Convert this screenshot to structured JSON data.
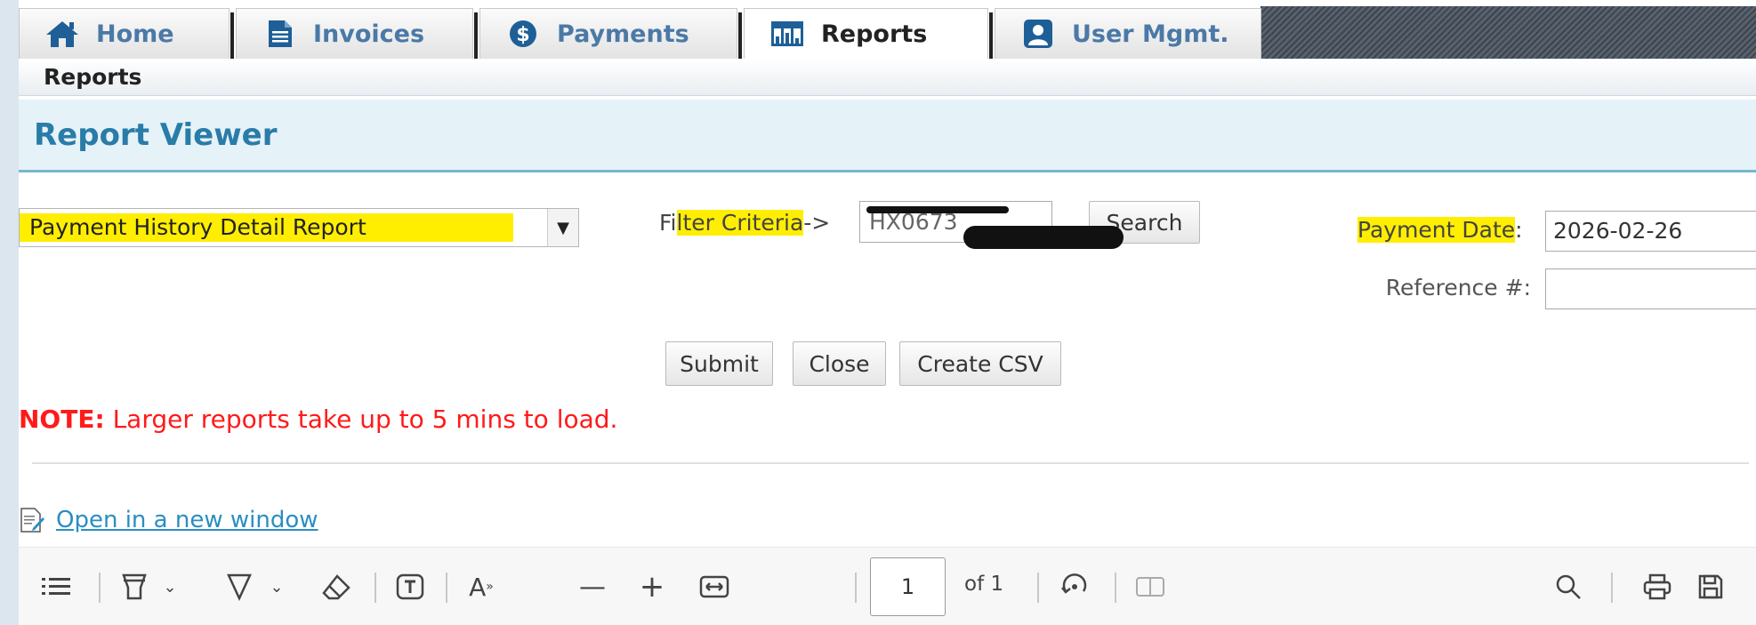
{
  "tabs": [
    {
      "label": "Home",
      "icon": "home-icon"
    },
    {
      "label": "Invoices",
      "icon": "invoice-icon"
    },
    {
      "label": "Payments",
      "icon": "payment-icon"
    },
    {
      "label": "Reports",
      "icon": "report-grid-icon",
      "active": true
    },
    {
      "label": "User Mgmt.",
      "icon": "user-icon"
    }
  ],
  "breadcrumb": "Reports",
  "panel": {
    "title": "Report Viewer"
  },
  "form": {
    "report_select": "Payment History Detail Report",
    "filter_label_a": "Fi",
    "filter_label_b": "lter Criteria",
    "filter_label_c": "->",
    "filter_value": "HX0673",
    "search_label": "Search",
    "payment_date_label": "Payment Date",
    "payment_date_colon": ":",
    "payment_date_value": "2026-02-26",
    "reference_label": "Reference #:",
    "reference_value": "",
    "submit_label": "Submit",
    "close_label": "Close",
    "csv_label": "Create CSV"
  },
  "note": {
    "prefix": "NOTE:",
    "text": " Larger reports take up to 5 mins to load."
  },
  "open_link": "Open in a new window",
  "pdf_toolbar": {
    "page_value": "1",
    "page_total": "of 1"
  },
  "colors": {
    "accent": "#2a7ca8",
    "note": "#ff1a1a",
    "highlight": "#ffee00",
    "link": "#2a8ec2"
  }
}
